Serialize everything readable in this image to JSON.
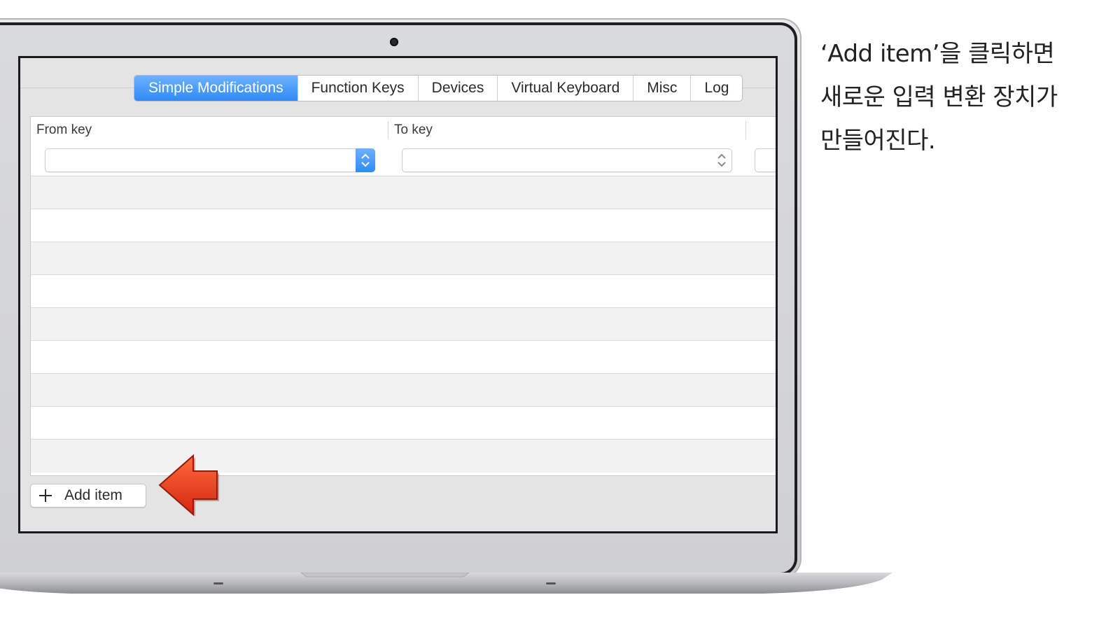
{
  "tabs": [
    {
      "label": "Simple Modifications",
      "active": true
    },
    {
      "label": "Function Keys",
      "active": false
    },
    {
      "label": "Devices",
      "active": false
    },
    {
      "label": "Virtual Keyboard",
      "active": false
    },
    {
      "label": "Misc",
      "active": false
    },
    {
      "label": "Log",
      "active": false
    }
  ],
  "table": {
    "columns": [
      "From key",
      "To key"
    ],
    "from_value": "",
    "to_value": ""
  },
  "add_button": {
    "label": "Add item",
    "icon": "plus-icon"
  },
  "annotation": {
    "icon": "red-arrow-icon",
    "color": "#e2361c"
  },
  "caption": {
    "lines": [
      "‘Add item’을 클릭하면",
      "새로운 입력 변환 장치가",
      "만들어진다."
    ]
  },
  "colors": {
    "accent": "#2f8bf6",
    "arrow": "#e2361c"
  }
}
